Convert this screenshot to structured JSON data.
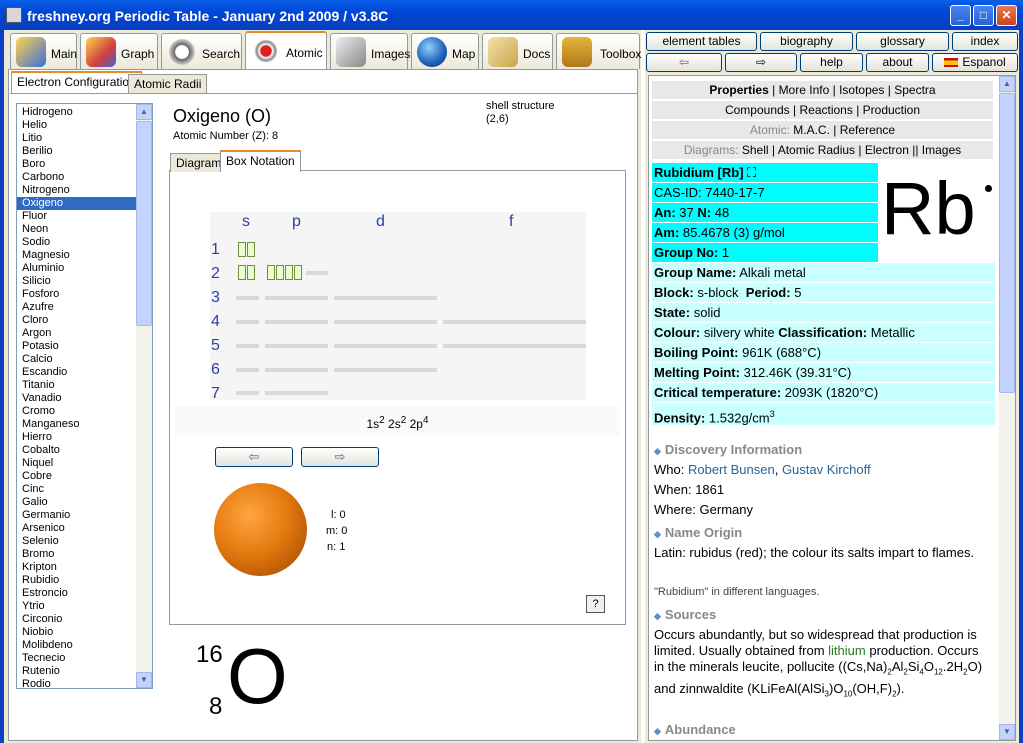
{
  "window": {
    "title": "freshney.org Periodic Table - January 2nd 2009 / v3.8C"
  },
  "main_tabs": [
    {
      "label": "Main",
      "icon": "blocks-icon",
      "selected": false
    },
    {
      "label": "Graph",
      "icon": "bar-graph-icon",
      "selected": false
    },
    {
      "label": "Search",
      "icon": "magnifier-icon",
      "selected": false
    },
    {
      "label": "Atomic",
      "icon": "atom-icon",
      "selected": true
    },
    {
      "label": "Images",
      "icon": "images-icon",
      "selected": false
    },
    {
      "label": "Map",
      "icon": "globe-icon",
      "selected": false
    },
    {
      "label": "Docs",
      "icon": "folder-icon",
      "selected": false
    },
    {
      "label": "Toolbox",
      "icon": "toolbox-icon",
      "selected": false
    }
  ],
  "sub_tabs": [
    {
      "label": "Electron Configuration",
      "selected": true
    },
    {
      "label": "Atomic Radii",
      "selected": false
    }
  ],
  "elements": [
    "Hidrogeno",
    "Helio",
    "Litio",
    "Berilio",
    "Boro",
    "Carbono",
    "Nitrogeno",
    "Oxigeno",
    "Fluor",
    "Neon",
    "Sodio",
    "Magnesio",
    "Aluminio",
    "Silicio",
    "Fosforo",
    "Azufre",
    "Cloro",
    "Argon",
    "Potasio",
    "Calcio",
    "Escandio",
    "Titanio",
    "Vanadio",
    "Cromo",
    "Manganeso",
    "Hierro",
    "Cobalto",
    "Niquel",
    "Cobre",
    "Cinc",
    "Galio",
    "Germanio",
    "Arsenico",
    "Selenio",
    "Bromo",
    "Kripton",
    "Rubidio",
    "Estroncio",
    "Ytrio",
    "Circonio",
    "Niobio",
    "Molibdeno",
    "Tecnecio",
    "Rutenio",
    "Rodio"
  ],
  "selected_element_index": 7,
  "element": {
    "name": "Oxigeno (O)",
    "atomic_number": "Atomic Number (Z): 8",
    "shell_label": "shell structure",
    "shell_value": "(2,6)",
    "mass_number": "16",
    "atomic_num_small": "8",
    "symbol": "O"
  },
  "view_tabs": [
    {
      "label": "Diagram",
      "selected": false
    },
    {
      "label": "Box Notation",
      "selected": true
    }
  ],
  "box_notation": {
    "orbitals": [
      "s",
      "p",
      "d",
      "f"
    ],
    "shells": [
      "1",
      "2",
      "3",
      "4",
      "5",
      "6",
      "7"
    ],
    "config": {
      "p1": "1s",
      "e1": "2",
      "p2": " 2s",
      "e2": "2",
      "p3": " 2p",
      "e3": "4"
    }
  },
  "nav": {
    "prev": "⇦",
    "next": "⇨"
  },
  "quantum": {
    "l": "l: 0",
    "m": "m: 0",
    "n": "n: 1"
  },
  "help_label": "?",
  "right_buttons": {
    "row1": [
      "element tables",
      "biography",
      "glossary",
      "index"
    ],
    "row2_back": "⇦",
    "row2_forward": "⇨",
    "help": "help",
    "about": "about",
    "espanol": "Espanol"
  },
  "info_nav": {
    "row1": [
      "Properties",
      "More Info",
      "Isotopes",
      "Spectra"
    ],
    "row2": [
      "Compounds",
      "Reactions",
      "Production"
    ],
    "row3_label": "Atomic:",
    "row3": [
      "M.A.C.",
      "Reference"
    ],
    "row4_label": "Diagrams:",
    "row4": [
      "Shell",
      "Atomic Radius",
      "Electron",
      "Images"
    ]
  },
  "properties": {
    "name_line": "Rubidium [Rb]",
    "big_symbol": "Rb",
    "cas": "CAS-ID: 7440-17-7",
    "an_label": "An:",
    "an": "37",
    "n_label": "N:",
    "n": "48",
    "am_label": "Am:",
    "am": "85.4678 (3) g/mol",
    "group_no_label": "Group No:",
    "group_no": "1",
    "group_name_label": "Group Name:",
    "group_name": "Alkali metal",
    "block_label": "Block:",
    "block": "s-block",
    "period_label": "Period:",
    "period": "5",
    "state_label": "State:",
    "state": "solid",
    "colour_label": "Colour:",
    "colour": "silvery white",
    "class_label": "Classification:",
    "class": "Metallic",
    "bp_label": "Boiling Point:",
    "bp": "961K (688°C)",
    "mp_label": "Melting Point:",
    "mp": "312.46K (39.31°C)",
    "ct_label": "Critical temperature:",
    "ct": "2093K (1820°C)",
    "density_label": "Density:",
    "density": "1.532g/cm",
    "density_exp": "3"
  },
  "discovery": {
    "title": "Discovery Information",
    "who_label": "Who:",
    "who1": "Robert Bunsen",
    "who2": "Gustav Kirchoff",
    "when_label": "When:",
    "when": "1861",
    "where_label": "Where:",
    "where": "Germany"
  },
  "origin": {
    "title": "Name Origin",
    "text": "Latin: rubidus (red); the colour its salts impart to flames.",
    "languages": "\"Rubidium\" in different languages."
  },
  "sources": {
    "title": "Sources",
    "text_a": "Occurs abundantly, but so widespread that production is limited. Usually obtained from",
    "lithium": "lithium",
    "text_b": "production. Occurs in the minerals leucite, pollucite ((Cs,Na)",
    "text_c": "and zinnwaldite (KLiFeAl(AlSi",
    "text_d": ")O",
    "text_e": "(OH,F)",
    "text_f": ")."
  },
  "abundance": {
    "title": "Abundance"
  },
  "colors": {
    "accent": "#00fcfc",
    "accent_light": "#c8ffff",
    "selection": "#316ac5"
  }
}
